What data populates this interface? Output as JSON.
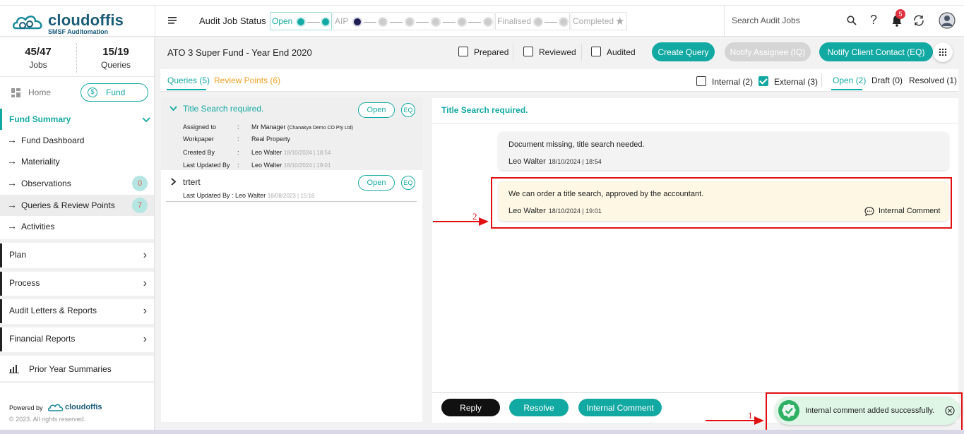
{
  "brand": {
    "name": "cloudoffis",
    "tagline": "SMSF Auditomation"
  },
  "header": {
    "status_label": "Audit Job Status",
    "stages": [
      "Open",
      "AIP",
      "Finalised",
      "Completed"
    ],
    "search_placeholder": "Search Audit Jobs",
    "help": "?",
    "notification_count": "5"
  },
  "sidebar": {
    "jobs_count": "45/47",
    "jobs_label": "Jobs",
    "queries_count": "15/19",
    "queries_label": "Queries",
    "home_label": "Home",
    "fund_label": "Fund",
    "fund_summary": "Fund Summary",
    "items": [
      {
        "label": "Fund Dashboard"
      },
      {
        "label": "Materiality"
      },
      {
        "label": "Observations",
        "badge": "0"
      },
      {
        "label": "Queries & Review Points",
        "badge": "7"
      },
      {
        "label": "Activities"
      }
    ],
    "sections": [
      "Plan",
      "Process",
      "Audit Letters & Reports",
      "Financial Reports"
    ],
    "prior_year": "Prior Year Summaries",
    "powered_by": "Powered by",
    "copyright": "© 2023. All rights reserved."
  },
  "subheader": {
    "fund_title": "ATO 3 Super Fund - Year End 2020",
    "prepared": "Prepared",
    "reviewed": "Reviewed",
    "audited": "Audited",
    "create_query": "Create Query",
    "notify_assignee": "Notify Assignee (IQ)",
    "notify_client": "Notify Client Contact (EQ)"
  },
  "tabs": {
    "queries": "Queries (5)",
    "review_points": "Review Points (6)",
    "internal": "Internal (2)",
    "external": "External (3)",
    "open": "Open (2)",
    "draft": "Draft (0)",
    "resolved": "Resolved (1)"
  },
  "queries": [
    {
      "title": "Title Search required.",
      "status": "Open",
      "eq": "EQ",
      "assigned_label": "Assigned to",
      "assigned_value": "Mr Manager",
      "assigned_org": "(Chanakya Demo CO Pty Ltd)",
      "workpaper_label": "Workpaper",
      "workpaper_value": "Real Property",
      "created_label": "Created By",
      "created_value": "Leo Walter",
      "created_ts": "18/10/2024 | 18:54",
      "updated_label": "Last Updated By",
      "updated_value": "Leo Walter",
      "updated_ts": "18/10/2024 | 19:01",
      "colon": ":"
    },
    {
      "title": "trtert",
      "status": "Open",
      "eq": "EQ",
      "updated_text": "Last Updated By : Leo Walter",
      "updated_ts": "18/08/2023 | 15:16"
    }
  ],
  "conversation": {
    "title": "Title Search required.",
    "messages": [
      {
        "body": "Document missing, title search needed.",
        "author": "Leo Walter",
        "ts": "18/10/2024 | 18:54"
      },
      {
        "body": "We can order a title search, approved by the accountant.",
        "author": "Leo Walter",
        "ts": "18/10/2024 | 19:01",
        "tag": "Internal Comment"
      }
    ],
    "actions": {
      "reply": "Reply",
      "resolve": "Resolve",
      "internal_comment": "Internal Comment"
    }
  },
  "toast": {
    "message": "Internal comment added successfully."
  },
  "annotations": {
    "one": "1",
    "two": "2"
  },
  "colors": {
    "teal": "#13a9a3",
    "red": "#e01010",
    "review_orange": "#f0a020"
  }
}
